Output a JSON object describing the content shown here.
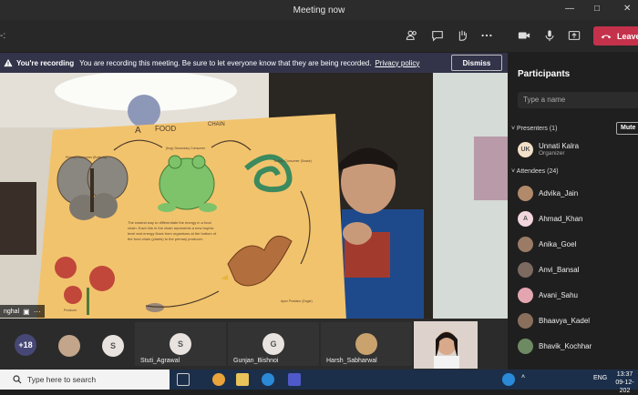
{
  "window": {
    "title": "Meeting now",
    "minimize": "—",
    "maximize": "□",
    "close": "✕"
  },
  "toolbar": {
    "timer": "-:",
    "leave_label": "Leave",
    "icons": [
      "people-icon",
      "chat-icon",
      "raise-hand-icon",
      "more-icon",
      "camera-icon",
      "mic-icon",
      "share-icon",
      "phone-icon"
    ]
  },
  "banner": {
    "title": "You're recording",
    "message": "You are recording this meeting. Be sure to let everyone know that they are being recorded.",
    "link": "Privacy policy",
    "dismiss": "Dismiss"
  },
  "video": {
    "name": "nghal",
    "chart": {
      "title_a": "A",
      "title_food": "FOOD",
      "title_chain": "CHAIN",
      "butterfly_label": "Primary Consumer (Butterfly)",
      "frog_label": "(frog) Secondary Consumer",
      "snake_label": "Tertiary Consumer (Snake)",
      "eagle_label": "Apex Predator (Eagle)",
      "plant_label": "Producer",
      "body": "The easiest way to differentiate the energy in a food chain. Each link in the chain represents a new trophic level and energy flows from organisms at the bottom of the food chain (plants) to the primary producer."
    }
  },
  "strip": {
    "overflow": "+18",
    "tiles": [
      {
        "name": "",
        "initial": "",
        "color": "#c2a58a"
      },
      {
        "name": "",
        "initial": "S",
        "color": "#e8e3de"
      },
      {
        "name": "Stuti_Agrawal",
        "initial": "S",
        "color": "#e8e3de"
      },
      {
        "name": "Gunjan_Bishnoi",
        "initial": "G",
        "color": "#e8e3de"
      },
      {
        "name": "Harsh_Sabharwal",
        "initial": "",
        "color": "#c9a26e"
      }
    ]
  },
  "panel": {
    "title": "Participants",
    "search_placeholder": "Type a name",
    "presenters_label": "Presenters (1)",
    "mute_label": "Mute",
    "attendees_label": "Attendees (24)",
    "presenters": [
      {
        "name": "Unnati Kalra",
        "role": "Organizer",
        "initials": "UK",
        "color": "#f3e0c8"
      }
    ],
    "attendees": [
      {
        "name": "Advika_Jain",
        "initials": "",
        "color": "#b08a6a"
      },
      {
        "name": "Ahmad_Khan",
        "initials": "A",
        "color": "#f2d5dd"
      },
      {
        "name": "Anika_Goel",
        "initials": "",
        "color": "#9b7b65"
      },
      {
        "name": "Anvi_Bansal",
        "initials": "",
        "color": "#7c6a60"
      },
      {
        "name": "Avani_Sahu",
        "initials": "",
        "color": "#e3a6b0"
      },
      {
        "name": "Bhaavya_Kadel",
        "initials": "",
        "color": "#8a6f5c"
      },
      {
        "name": "Bhavik_Kochhar",
        "initials": "",
        "color": "#6d8a63"
      }
    ]
  },
  "taskbar": {
    "search_placeholder": "Type here to search",
    "lang": "ENG",
    "time": "13:37",
    "date": "09-12-202"
  },
  "colors": {
    "accent": "#c4314b",
    "banner": "#33344a",
    "panel": "#201f1f"
  }
}
